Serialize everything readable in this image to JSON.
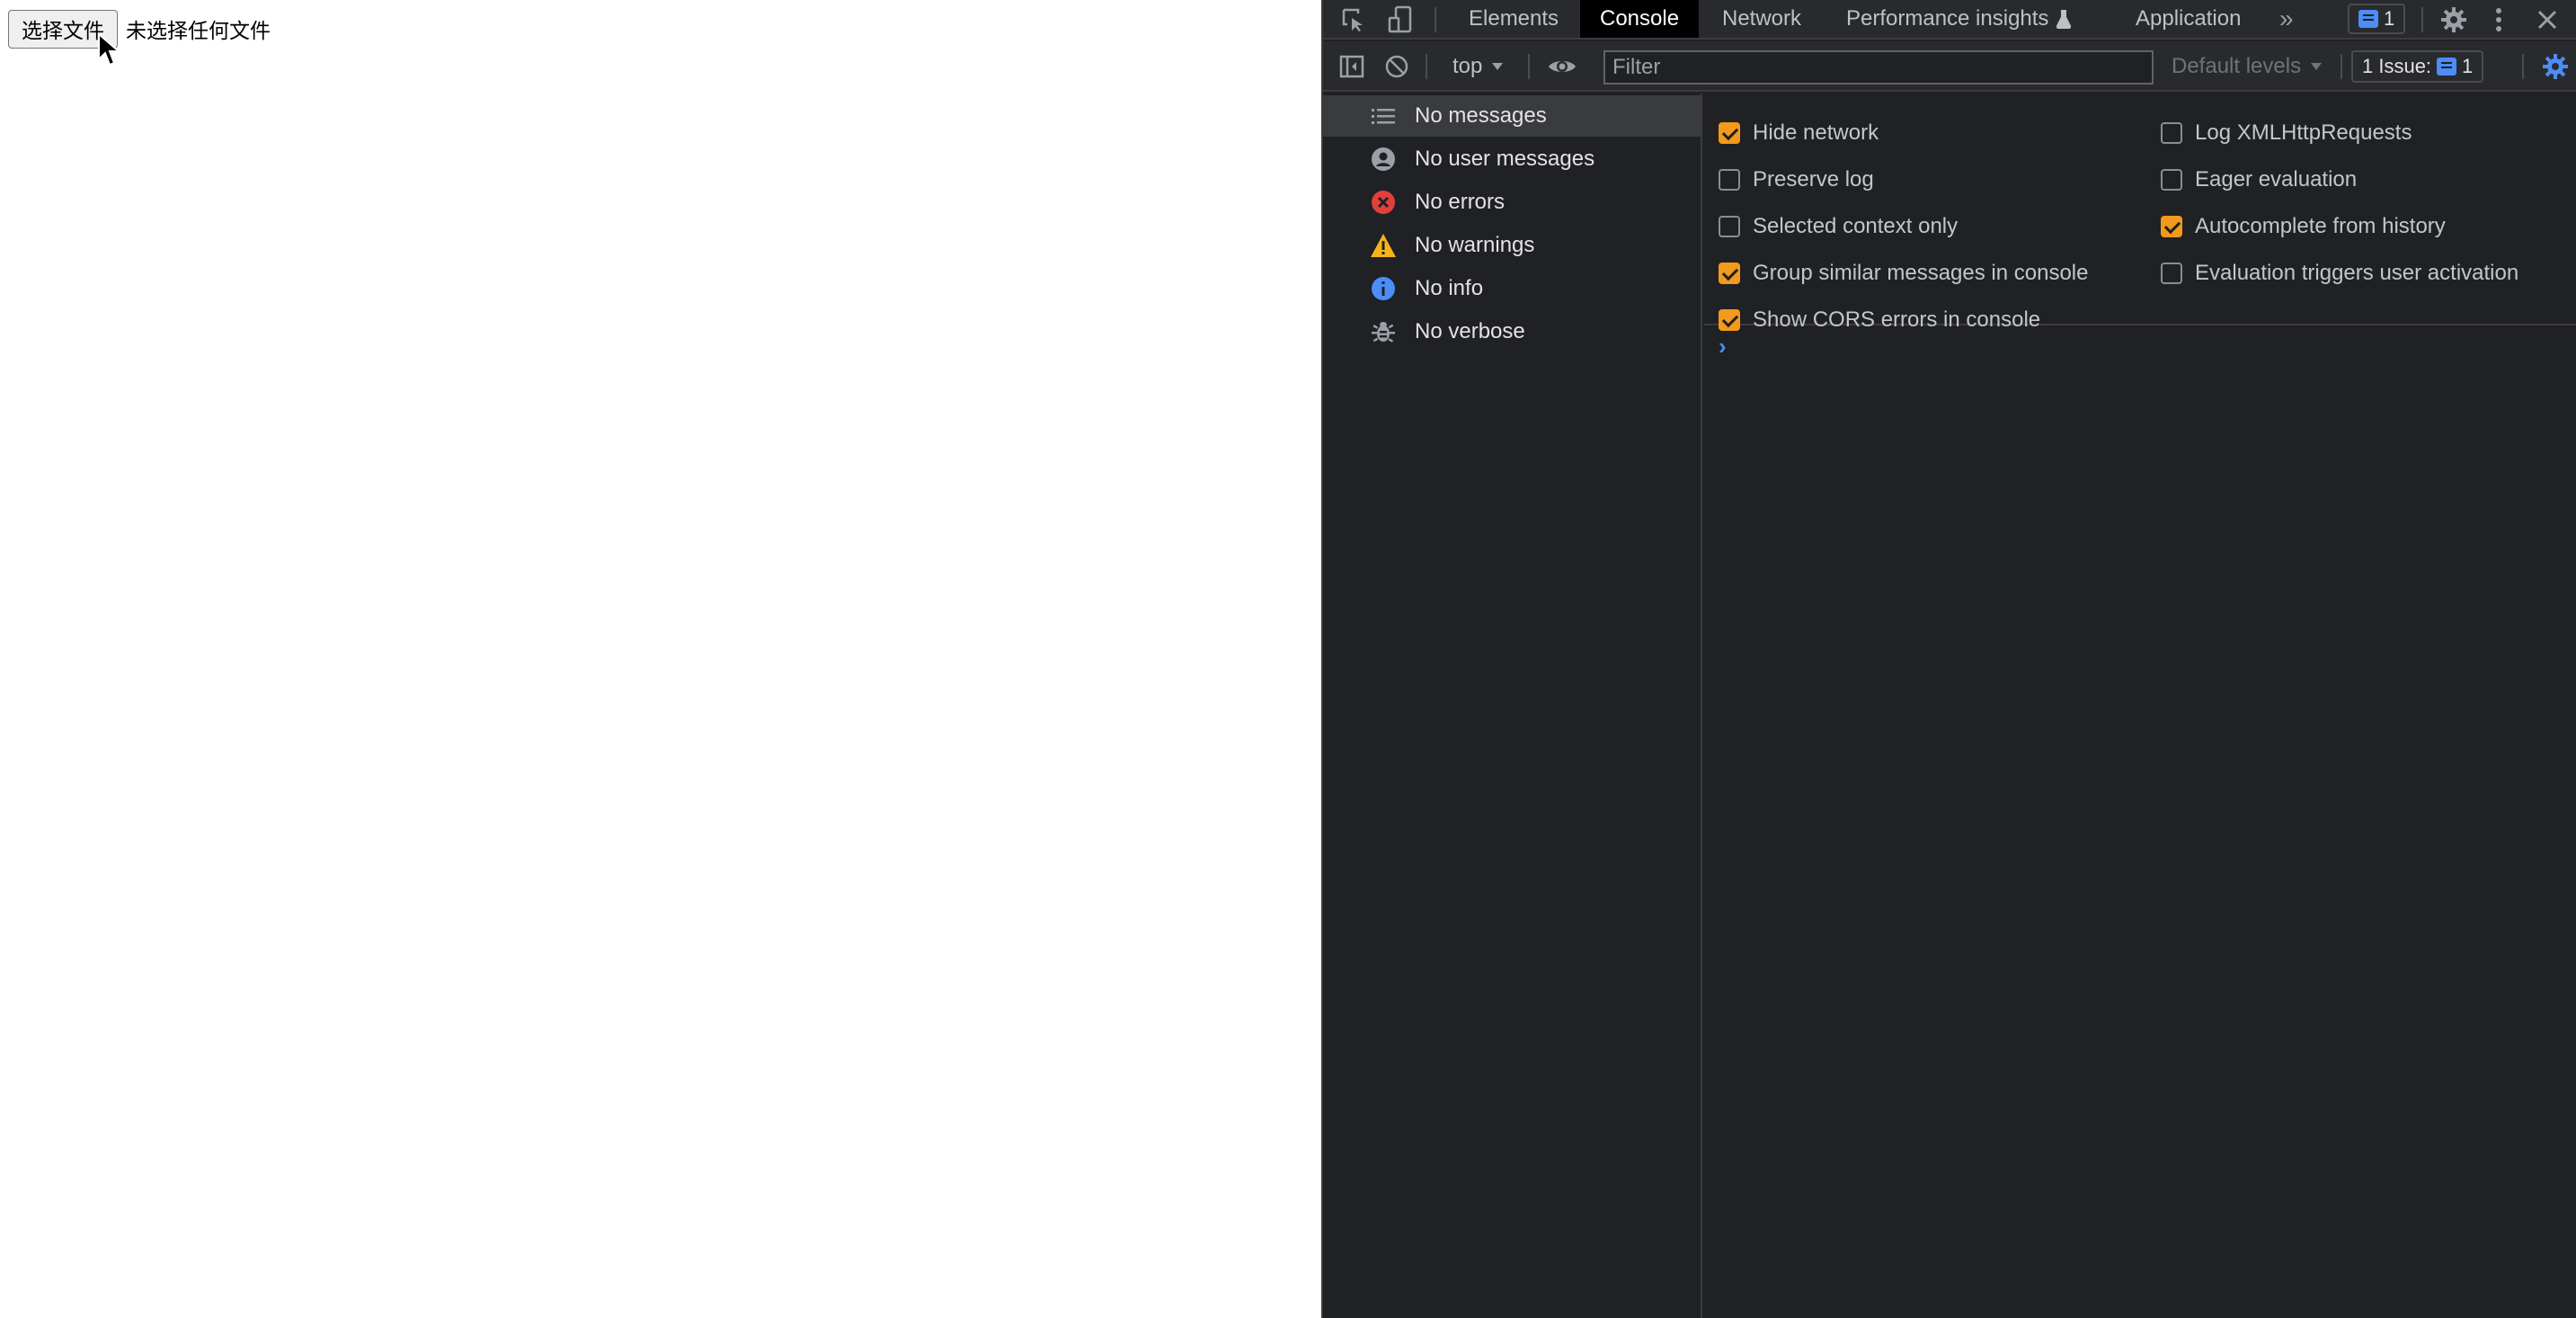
{
  "page": {
    "file_button_label": "选择文件",
    "file_status": "未选择任何文件"
  },
  "devtools": {
    "tabs": [
      {
        "label": "Elements",
        "active": false
      },
      {
        "label": "Console",
        "active": true
      },
      {
        "label": "Network",
        "active": false
      },
      {
        "label": "Performance insights",
        "active": false
      },
      {
        "label": "Application",
        "active": false
      }
    ],
    "more_tabs_glyph": "»",
    "messages_badge_count": "1",
    "toolbar": {
      "context": "top",
      "filter_placeholder": "Filter",
      "levels": "Default levels",
      "issues_label": "1 Issue:",
      "issues_count": "1"
    },
    "sidebar": [
      {
        "label": "No messages",
        "icon": "list-icon",
        "selected": true
      },
      {
        "label": "No user messages",
        "icon": "user-icon",
        "selected": false
      },
      {
        "label": "No errors",
        "icon": "error-icon",
        "selected": false
      },
      {
        "label": "No warnings",
        "icon": "warning-icon",
        "selected": false
      },
      {
        "label": "No info",
        "icon": "info-icon",
        "selected": false
      },
      {
        "label": "No verbose",
        "icon": "bug-icon",
        "selected": false
      }
    ],
    "settings_left": [
      {
        "label": "Hide network",
        "checked": true
      },
      {
        "label": "Preserve log",
        "checked": false
      },
      {
        "label": "Selected context only",
        "checked": false
      },
      {
        "label": "Group similar messages in console",
        "checked": true
      },
      {
        "label": "Show CORS errors in console",
        "checked": true
      }
    ],
    "settings_right": [
      {
        "label": "Log XMLHttpRequests",
        "checked": false
      },
      {
        "label": "Eager evaluation",
        "checked": false
      },
      {
        "label": "Autocomplete from history",
        "checked": true
      },
      {
        "label": "Evaluation triggers user activation",
        "checked": false
      }
    ],
    "prompt_glyph": "›"
  },
  "colors": {
    "checkbox_on": "#f29a1b",
    "accent_blue": "#4c8df6",
    "error_red": "#e0403b",
    "warning_yellow": "#f6b31b"
  }
}
